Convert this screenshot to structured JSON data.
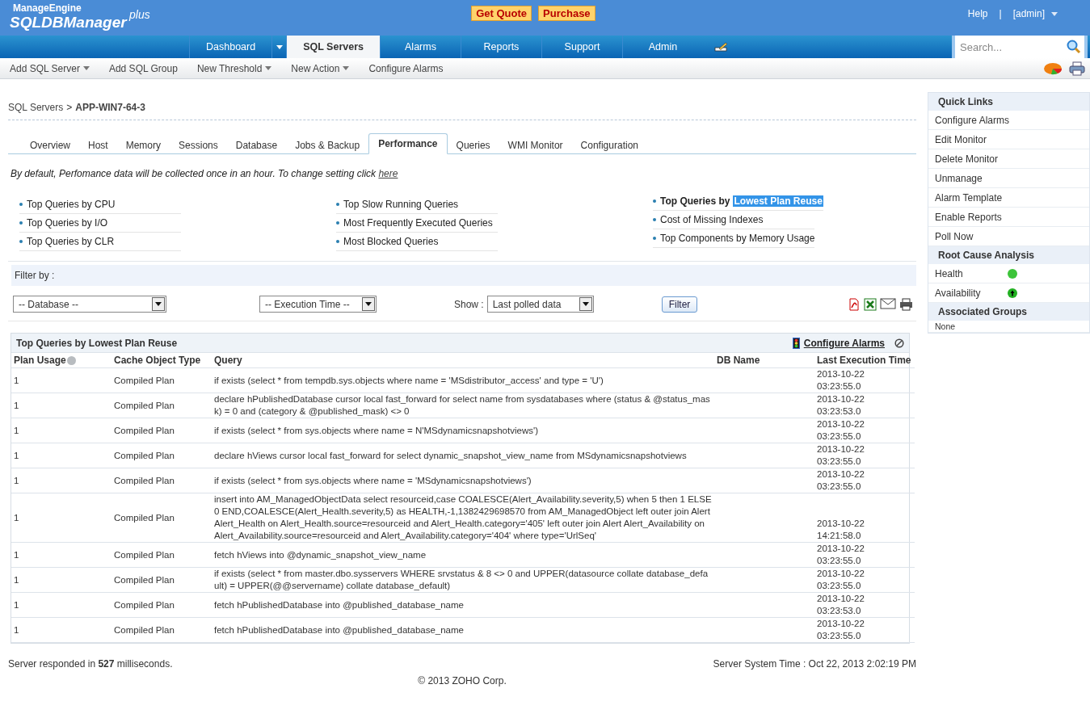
{
  "header": {
    "logo": {
      "brand": "ManageEngine",
      "product": "SQLDBManager",
      "edition": "plus"
    },
    "buttons": [
      "Get Quote",
      "Purchase"
    ],
    "help": "Help",
    "separator": "|",
    "user": "[admin]"
  },
  "nav": {
    "tabs": [
      {
        "label": "Dashboard",
        "selected": false,
        "has_menu": true
      },
      {
        "label": "SQL Servers",
        "selected": true,
        "has_menu": false
      },
      {
        "label": "Alarms",
        "selected": false,
        "has_menu": false
      },
      {
        "label": "Reports",
        "selected": false,
        "has_menu": false
      },
      {
        "label": "Support",
        "selected": false,
        "has_menu": false
      },
      {
        "label": "Admin",
        "selected": false,
        "has_menu": false
      }
    ],
    "search": {
      "placeholder": "Search..."
    }
  },
  "subnav": [
    {
      "label": "Add SQL Server",
      "has_menu": true
    },
    {
      "label": "Add SQL Group",
      "has_menu": false
    },
    {
      "label": "New Threshold",
      "has_menu": true
    },
    {
      "label": "New Action",
      "has_menu": true
    },
    {
      "label": "Configure Alarms",
      "has_menu": false
    }
  ],
  "breadcrumb": {
    "parent": "SQL Servers",
    "separator": ">",
    "current": "APP-WIN7-64-3"
  },
  "tabs": [
    {
      "label": "Overview",
      "selected": false
    },
    {
      "label": "Host",
      "selected": false
    },
    {
      "label": "Memory",
      "selected": false
    },
    {
      "label": "Sessions",
      "selected": false
    },
    {
      "label": "Database",
      "selected": false
    },
    {
      "label": "Jobs & Backup",
      "selected": false
    },
    {
      "label": "Performance",
      "selected": true
    },
    {
      "label": "Queries",
      "selected": false
    },
    {
      "label": "WMI Monitor",
      "selected": false
    },
    {
      "label": "Configuration",
      "selected": false
    }
  ],
  "notice": {
    "text": "By default, Perfomance data will be collected once in an hour. To change setting click",
    "link": "here"
  },
  "report_links": [
    [
      {
        "label": "Top Queries by CPU",
        "selected": false
      },
      {
        "label": "Top Queries by I/O",
        "selected": false
      },
      {
        "label": "Top Queries by CLR",
        "selected": false
      }
    ],
    [
      {
        "label": "Top Slow Running Queries",
        "selected": false
      },
      {
        "label": "Most Frequently Executed Queries",
        "selected": false
      },
      {
        "label": "Most Blocked Queries",
        "selected": false
      }
    ],
    [
      {
        "label": "Top Queries by",
        "highlight": "Lowest Plan Reuse",
        "selected": true
      },
      {
        "label": "Cost of Missing Indexes",
        "selected": false
      },
      {
        "label": "Top Components by Memory Usage",
        "selected": false
      }
    ]
  ],
  "filter": {
    "label": "Filter by :",
    "selects": [
      "-- Database --",
      "-- Execution Time --"
    ],
    "show_label": "Show :",
    "show_value": "Last polled data",
    "button": "Filter"
  },
  "table": {
    "title": "Top Queries by Lowest Plan Reuse",
    "configure_link": "Configure Alarms",
    "columns": [
      "Plan Usage",
      "Cache Object Type",
      "Query",
      "DB Name",
      "Last Execution Time"
    ],
    "rows": [
      {
        "plan_usage": "1",
        "cache_type": "Compiled Plan",
        "query": "if exists (select * from tempdb.sys.objects where name = 'MSdistributor_access' and type = 'U')",
        "time": [
          "2013-10-22",
          "03:23:55.0"
        ]
      },
      {
        "plan_usage": "1",
        "cache_type": "Compiled Plan",
        "query": "declare hPublishedDatabase cursor local fast_forward for select name from sysdatabases where (status & @status_mask) = 0 and (category & @published_mask) <> 0",
        "time": [
          "2013-10-22",
          "03:23:53.0"
        ]
      },
      {
        "plan_usage": "1",
        "cache_type": "Compiled Plan",
        "query": "if exists (select * from sys.objects where name = N'MSdynamicsnapshotviews')",
        "time": [
          "2013-10-22",
          "03:23:55.0"
        ]
      },
      {
        "plan_usage": "1",
        "cache_type": "Compiled Plan",
        "query": "declare hViews cursor local fast_forward for select dynamic_snapshot_view_name from MSdynamicsnapshotviews",
        "time": [
          "2013-10-22",
          "03:23:55.0"
        ]
      },
      {
        "plan_usage": "1",
        "cache_type": "Compiled Plan",
        "query": "if exists (select * from sys.objects where name = 'MSdynamicsnapshotviews')",
        "time": [
          "2013-10-22",
          "03:23:55.0"
        ]
      },
      {
        "plan_usage": "1",
        "cache_type": "Compiled Plan",
        "query": "insert into AM_ManagedObjectData select resourceid,case COALESCE(Alert_Availability.severity,5) when 5 then 1 ELSE 0 END,COALESCE(Alert_Health.severity,5) as HEALTH,-1,1382429698570 from AM_ManagedObject left outer join Alert Alert_Health on Alert_Health.source=resourceid and Alert_Health.category='405' left outer join Alert Alert_Availability on Alert_Availability.source=resourceid and Alert_Availability.category='404' where type='UrlSeq'",
        "time": [
          "2013-10-22",
          "14:21:58.0"
        ]
      },
      {
        "plan_usage": "1",
        "cache_type": "Compiled Plan",
        "query": "fetch hViews into @dynamic_snapshot_view_name",
        "time": [
          "2013-10-22",
          "03:23:55.0"
        ]
      },
      {
        "plan_usage": "1",
        "cache_type": "Compiled Plan",
        "query": "if exists (select * from master.dbo.sysservers WHERE srvstatus & 8 <> 0 and UPPER(datasource collate database_default) = UPPER(@@servername) collate database_default)",
        "time": [
          "2013-10-22",
          "03:23:55.0"
        ]
      },
      {
        "plan_usage": "1",
        "cache_type": "Compiled Plan",
        "query": "fetch hPublishedDatabase into @published_database_name",
        "time": [
          "2013-10-22",
          "03:23:53.0"
        ]
      },
      {
        "plan_usage": "1",
        "cache_type": "Compiled Plan",
        "query": "fetch hPublishedDatabase into @published_database_name",
        "time": [
          "2013-10-22",
          "03:23:55.0"
        ]
      }
    ]
  },
  "footer": {
    "response": "Server responded in **527** milliseconds.",
    "server_time": "Server System Time : Oct 22, 2013 2:02:19 PM",
    "copyright": "© 2013 ZOHO Corp."
  },
  "sidebar": [
    {
      "title": "Quick Links",
      "items": [
        {
          "label": "Configure Alarms"
        },
        {
          "label": "Edit Monitor"
        },
        {
          "label": "Delete Monitor"
        },
        {
          "label": "Unmanage"
        },
        {
          "label": "Alarm Template"
        },
        {
          "label": "Enable Reports"
        },
        {
          "label": "Poll Now"
        }
      ]
    },
    {
      "title": "Root Cause Analysis",
      "items": [
        {
          "label": "Health",
          "kind": "health"
        },
        {
          "label": "Availability",
          "kind": "availability"
        }
      ]
    },
    {
      "title": "Associated Groups",
      "items": [
        {
          "label": "None",
          "kind": "note"
        }
      ]
    }
  ]
}
